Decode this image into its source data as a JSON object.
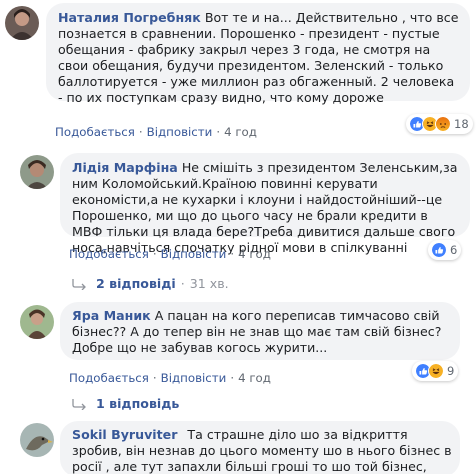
{
  "comments": [
    {
      "author": "Наталия Погребняк",
      "text": "Вот те и на... Действительно , что все познается в сравнении. Порошенко - президент - пустые обещания - фабрику закрыл через 3 года, не смотря на свои обещания, будучи президентом. Зеленский - только баллотируется - уже миллион раз обгаженный. 2 человека - по их поступкам сразу видно, что кому дороже",
      "like": "Подобається",
      "reply": "Відповісти",
      "time": "4 год",
      "reactions": "18"
    },
    {
      "author": "Лідія Марфіна",
      "text": "Не смішіть з президентом Зеленським,за ним Коломойський.Країною повинні керувати економісти,а не кухарки і клоуни і найдостойніший--це Порошенко, ми що до цього часу не брали кредити в МВФ тільки ця влада бере?Треба дивитися дальше свого носа,навчіться спочатку рідної мови в спілкуванні",
      "like": "Подобається",
      "reply": "Відповісти",
      "time": "4 год",
      "reactions": "6"
    },
    {
      "author": "Яра Маник",
      "text": "А пацан на кого переписав тимчасово свій бізнес?? А до тепер він не знав що має там свій бізнес? Добре що не забував когось журити...",
      "like": "Подобається",
      "reply": "Відповісти",
      "time": "4 год",
      "reactions": "9"
    },
    {
      "author": "Sokil Byruviter",
      "text": "Та страшне діло шо за відкриття зробив, він незнав до цього моменту шо в нього бізнес в росії , але тут запахли більші гроші то шо той бізнес, ПРИДУРКІ"
    }
  ],
  "reply_threads": [
    {
      "label": "2 відповіді",
      "time": "31 хв."
    },
    {
      "label": "1 відповідь"
    }
  ],
  "separator": "·",
  "colors": {
    "link": "#385898",
    "bubble": "#f2f3f5",
    "meta": "#606770",
    "like": "#4080ff",
    "haha": "#f7b125",
    "angry": "#e9710f"
  }
}
